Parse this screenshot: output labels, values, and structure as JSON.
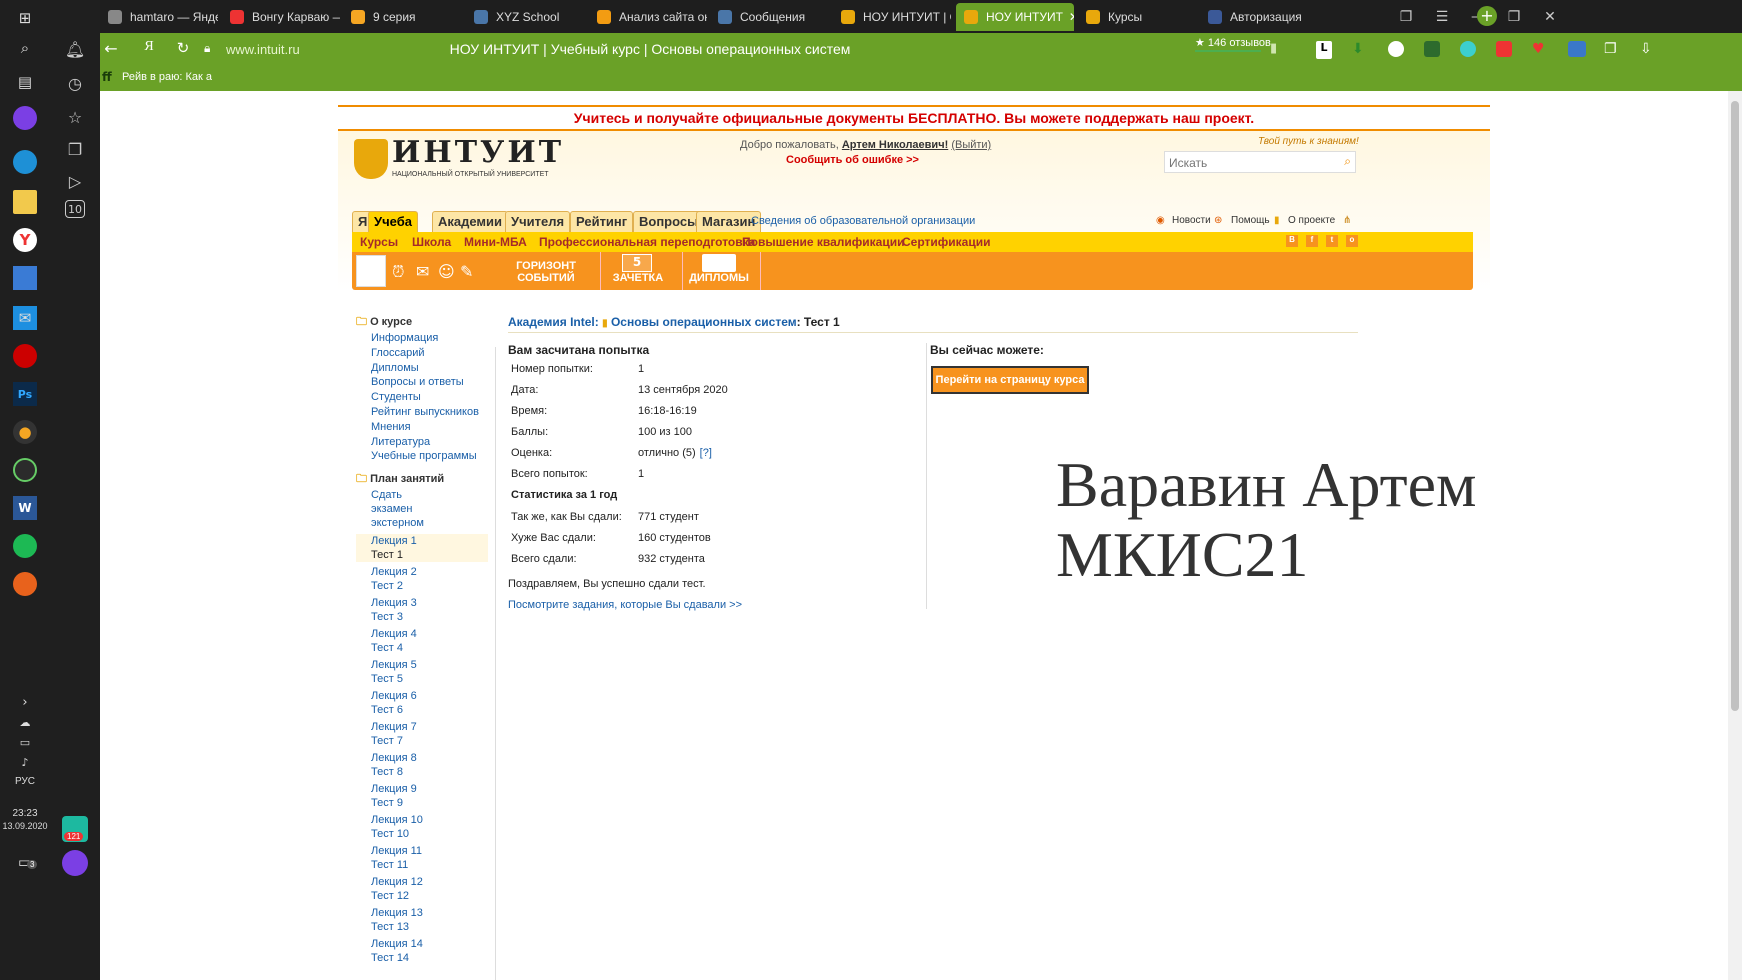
{
  "taskbar": {
    "language": "РУС",
    "time": "23:23",
    "date": "13.09.2020",
    "mail_badge": "121",
    "notif_badge": "3"
  },
  "browser": {
    "tabs": [
      {
        "label": "hamtaro — Яндек",
        "color": "#888"
      },
      {
        "label": "Вонгу Карваю —",
        "color": "#e33"
      },
      {
        "label": "9 серия",
        "color": "#f5a623"
      },
      {
        "label": "XYZ School",
        "color": "#4a76a8"
      },
      {
        "label": "Анализ сайта онл",
        "color": "#f39c12"
      },
      {
        "label": "Сообщения",
        "color": "#4a76a8"
      },
      {
        "label": "НОУ ИНТУИТ | Ос",
        "color": "#e8a80c"
      },
      {
        "label": "НОУ ИНТУИТ",
        "color": "#e8a80c"
      },
      {
        "label": "Курсы",
        "color": "#e8a80c"
      },
      {
        "label": "Авторизация",
        "color": "#3b5998"
      }
    ],
    "url": "www.intuit.ru",
    "page_title": "НОУ ИНТУИТ | Учебный курс | Основы операционных систем",
    "reviews": "★ 146 отзывов",
    "bookmark": "Рейв в раю: Как а"
  },
  "site": {
    "banner": "Учитесь и получайте официальные документы БЕСПЛАТНО. Вы можете поддержать наш проект.",
    "logo": "ИНТУИТ",
    "logo_sub": "НАЦИОНАЛЬНЫЙ ОТКРЫТЫЙ УНИВЕРСИТЕТ",
    "welcome": "Добро пожаловать,",
    "user": "Артем Николаевич!",
    "logout": "(Выйти)",
    "report_error": "Сообщить об ошибке >>",
    "slogan": "Твой путь к знаниям!",
    "search_placeholder": "Искать",
    "nav_tabs": [
      "Я",
      "Учеба",
      "Академии",
      "Учителя",
      "Рейтинг",
      "Вопросы",
      "Магазин"
    ],
    "org_info": "Сведения об образовательной организации",
    "top_links": [
      "Новости",
      "Помощь",
      "О проекте"
    ],
    "subnav": [
      "Курсы",
      "Школа",
      "Мини-МБА",
      "Профессиональная переподготовка",
      "Повышение квалификации",
      "Сертификации"
    ],
    "orbar": [
      "ГОРИЗОНТ СОБЫТИЙ",
      "ЗАЧЕТКА",
      "ДИПЛОМЫ"
    ],
    "sidebar": {
      "about_title": "О курсе",
      "about_links": [
        "Информация",
        "Глоссарий",
        "Дипломы",
        "Вопросы и ответы",
        "Студенты",
        "Рейтинг выпускников",
        "Мнения",
        "Литература",
        "Учебные программы"
      ],
      "plan_title": "План занятий",
      "exam": "Сдать экзамен экстерном",
      "lessons": [
        [
          "Лекция 1",
          "Тест 1"
        ],
        [
          "Лекция 2",
          "Тест 2"
        ],
        [
          "Лекция 3",
          "Тест 3"
        ],
        [
          "Лекция 4",
          "Тест 4"
        ],
        [
          "Лекция 5",
          "Тест 5"
        ],
        [
          "Лекция 6",
          "Тест 6"
        ],
        [
          "Лекция 7",
          "Тест 7"
        ],
        [
          "Лекция 8",
          "Тест 8"
        ],
        [
          "Лекция 9",
          "Тест 9"
        ],
        [
          "Лекция 10",
          "Тест 10"
        ],
        [
          "Лекция 11",
          "Тест 11"
        ],
        [
          "Лекция 12",
          "Тест 12"
        ],
        [
          "Лекция 13",
          "Тест 13"
        ],
        [
          "Лекция 14",
          "Тест 14"
        ]
      ]
    },
    "breadcrumb": {
      "academy": "Академия Intel",
      "course": "Основы операционных систем",
      "current": ": Тест 1"
    },
    "result": {
      "title": "Вам засчитана попытка",
      "rows": [
        [
          "Номер попытки:",
          "1"
        ],
        [
          "Дата:",
          "13 сентября 2020"
        ],
        [
          "Время:",
          "16:18-16:19"
        ],
        [
          "Баллы:",
          "100 из 100"
        ],
        [
          "Оценка:",
          "отлично (5)"
        ],
        [
          "Всего попыток:",
          "1"
        ]
      ],
      "help": "[?]",
      "stats_title": "Статистика за 1 год",
      "stats": [
        [
          "Так же, как Вы сдали:",
          "771 студент"
        ],
        [
          "Хуже Вас сдали:",
          "160 студентов"
        ],
        [
          "Всего сдали:",
          "932 студента"
        ]
      ],
      "congrats": "Поздравляем, Вы успешно сдали тест.",
      "view_tasks": "Посмотрите задания, которые Вы сдавали >>"
    },
    "right": {
      "title": "Вы сейчас можете:",
      "button": "Перейти на страницу курса"
    },
    "overlay": {
      "line1": "Варавин Артем",
      "line2": "МКИС21"
    }
  }
}
